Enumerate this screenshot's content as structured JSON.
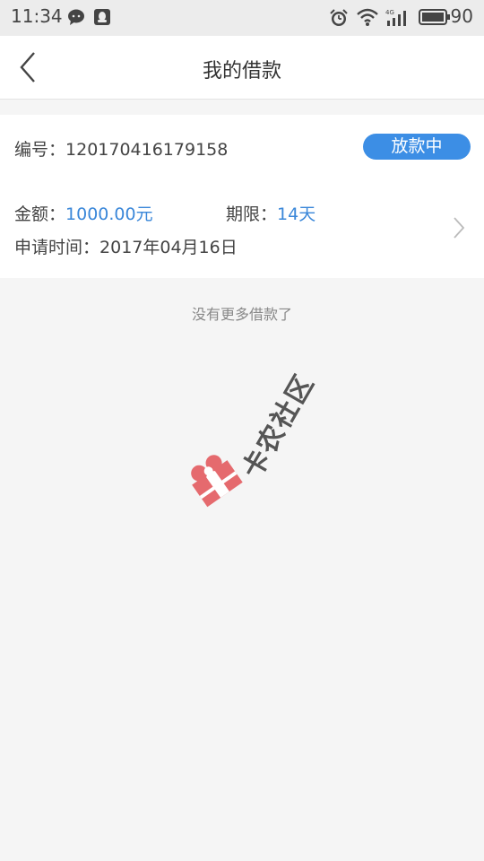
{
  "status_bar": {
    "time": "11:34",
    "network": "4G",
    "battery": "90",
    "left_icons": [
      "chat-bubble-icon",
      "qq-penguin-icon"
    ],
    "right_icons": [
      "alarm-icon",
      "wifi-icon",
      "signal-icon",
      "battery-icon"
    ]
  },
  "header": {
    "title": "我的借款",
    "back_icon": "chevron-left-icon"
  },
  "loan": {
    "number_label": "编号：",
    "number_value": "120170416179158",
    "status": "放款中",
    "amount_label": "金额：",
    "amount_value": "1000.00元",
    "term_label": "期限：",
    "term_value": "14天",
    "date_label": "申请时间：",
    "date_value": "2017年04月16日"
  },
  "list_footer": "没有更多借款了",
  "watermark": {
    "text": "卡农社区"
  },
  "colors": {
    "accent": "#3c8ee5",
    "value_blue": "#3a87d9",
    "background": "#f5f5f5"
  }
}
